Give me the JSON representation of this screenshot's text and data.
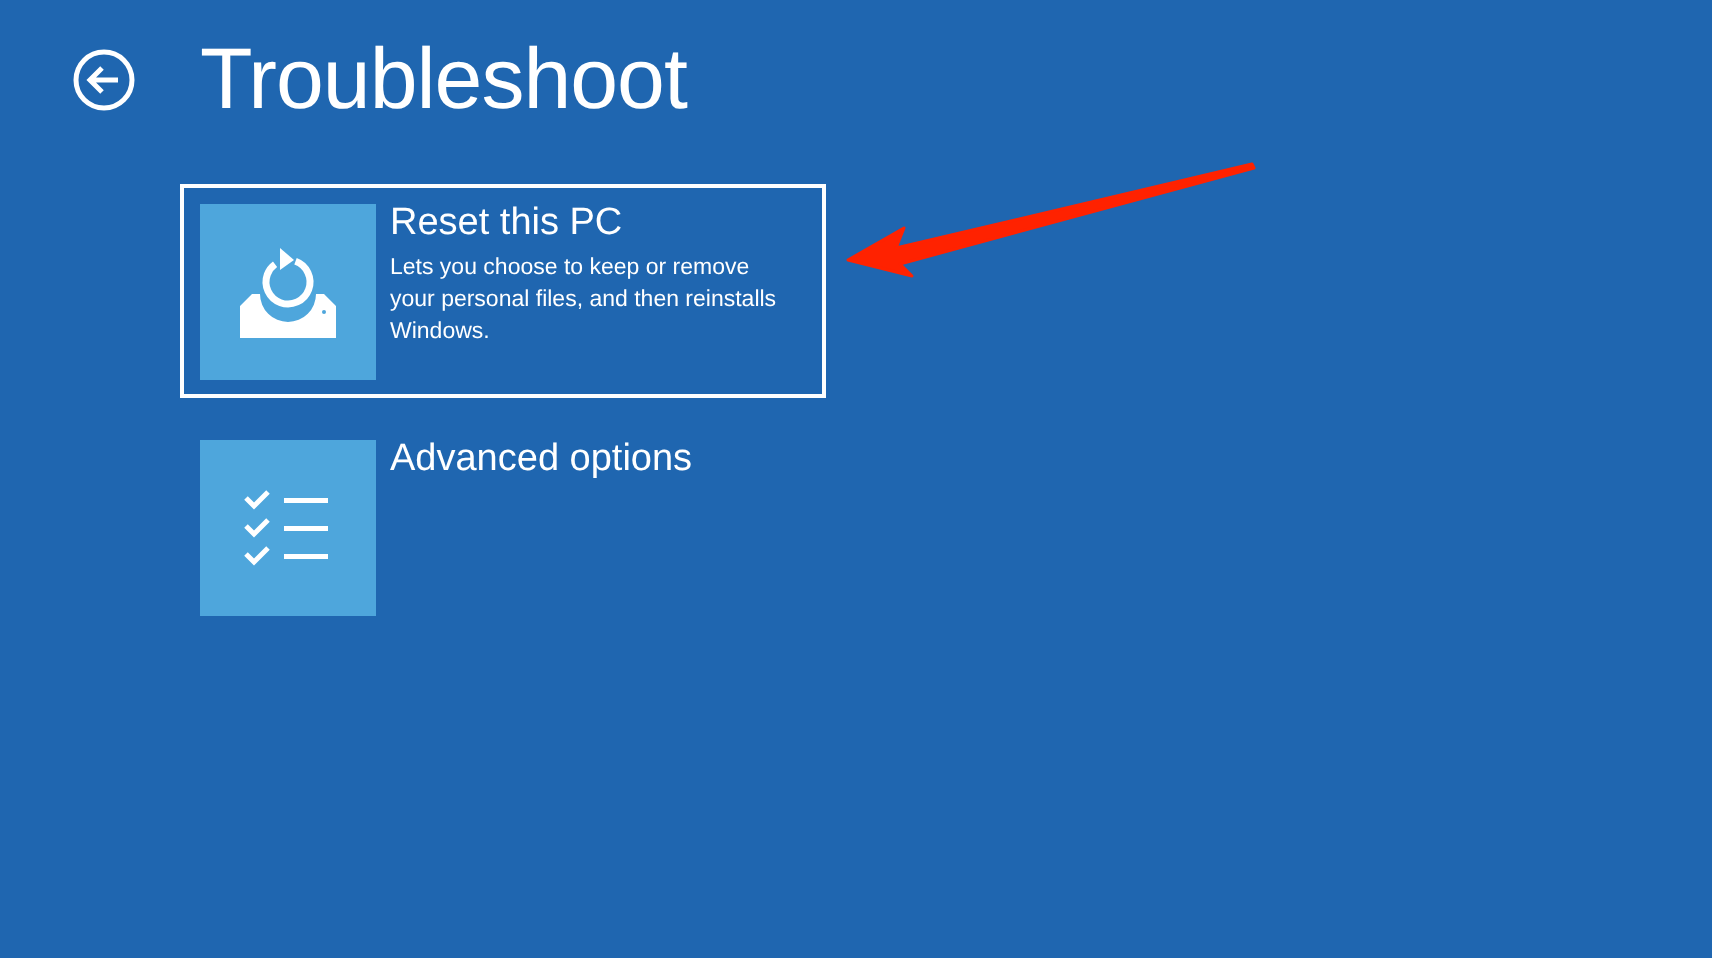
{
  "header": {
    "title": "Troubleshoot"
  },
  "options": [
    {
      "kind": "reset",
      "title": "Reset this PC",
      "description": "Lets you choose to keep or remove your personal files, and then reinstalls Windows.",
      "selected": true
    },
    {
      "kind": "advanced",
      "title": "Advanced options",
      "selected": false
    }
  ]
}
